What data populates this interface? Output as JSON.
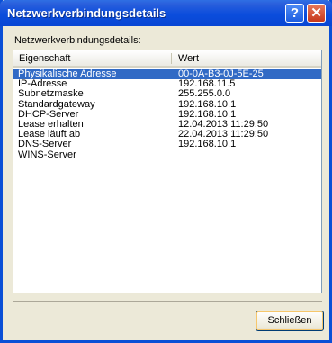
{
  "window": {
    "title": "Netzwerkverbindungsdetails",
    "help_glyph": "?",
    "close_glyph": "✕"
  },
  "dialog": {
    "label": "Netzwerkverbindungsdetails:",
    "columns": [
      "Eigenschaft",
      "Wert"
    ],
    "rows": [
      {
        "property": "Physikalische Adresse",
        "value": "00-0A-B3-0J-5E-25",
        "selected": true
      },
      {
        "property": "IP-Adresse",
        "value": "192.168.11.5"
      },
      {
        "property": "Subnetzmaske",
        "value": "255.255.0.0"
      },
      {
        "property": "Standardgateway",
        "value": "192.168.10.1"
      },
      {
        "property": "DHCP-Server",
        "value": "192.168.10.1"
      },
      {
        "property": "Lease erhalten",
        "value": "12.04.2013 11:29:50"
      },
      {
        "property": "Lease läuft ab",
        "value": "22.04.2013 11:29:50"
      },
      {
        "property": "DNS-Server",
        "value": "192.168.10.1"
      },
      {
        "property": "WINS-Server",
        "value": ""
      }
    ],
    "close_button": "Schließen"
  },
  "colors": {
    "titlebar": "#0b4ddc",
    "selection": "#316ac5",
    "dialog_bg": "#ece9d8"
  }
}
